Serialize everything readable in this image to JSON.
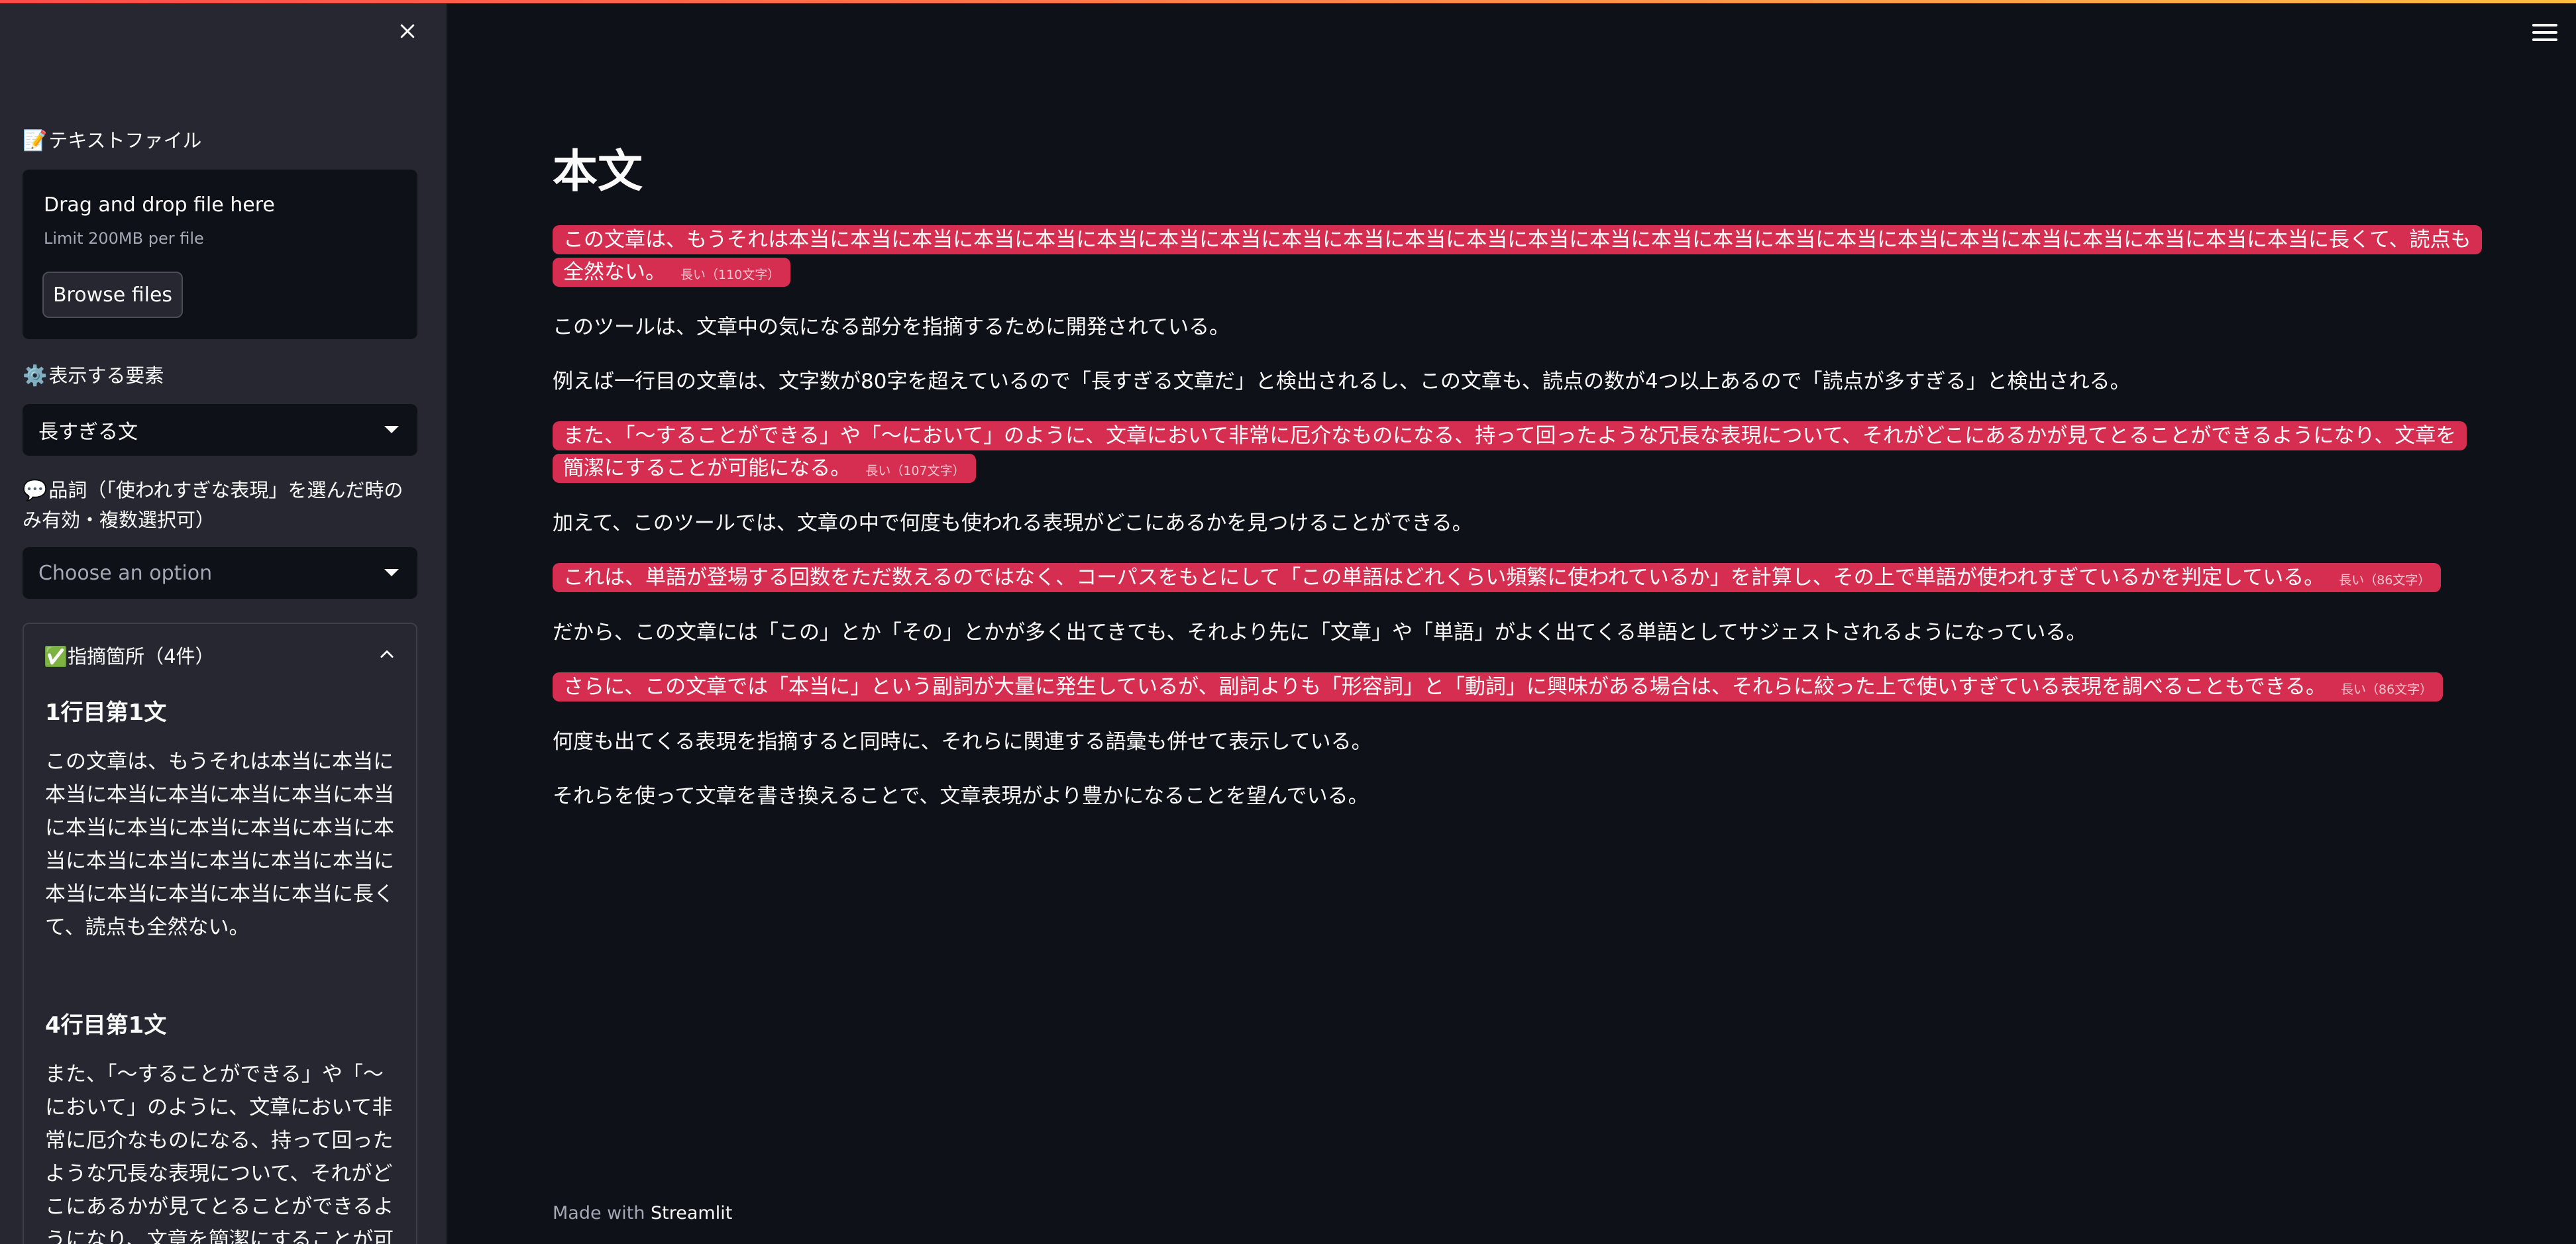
{
  "sidebar": {
    "close_icon": "close-icon",
    "file_label_emoji": "📝",
    "file_label": "テキストファイル",
    "uploader": {
      "title": "Drag and drop file here",
      "limit": "Limit 200MB per file",
      "browse_label": "Browse files"
    },
    "element_label_emoji": "⚙️",
    "element_label": "表示する要素",
    "element_select_value": "長すぎる文",
    "pos_label_emoji": "💬",
    "pos_label": "品詞（「使われすぎな表現」を選んだ時のみ有効・複数選択可）",
    "pos_select_placeholder": "Choose an option",
    "expander": {
      "emoji": "✅",
      "title": "指摘箇所（4件）",
      "findings": [
        {
          "heading": "1行目第1文",
          "text": "この文章は、もうそれは本当に本当に本当に本当に本当に本当に本当に本当に本当に本当に本当に本当に本当に本当に本当に本当に本当に本当に本当に本当に本当に本当に本当に本当に長くて、読点も全然ない。"
        },
        {
          "heading": "4行目第1文",
          "text": "また、「〜することができる」や「〜において」のように、文章において非常に厄介なものになる、持って回ったような冗長な表現について、それがどこにあるかが見てとることができるようになり、文章を簡潔にすることが可能になる。"
        }
      ]
    }
  },
  "main": {
    "title": "本文",
    "lines": [
      {
        "text": "この文章は、もうそれは本当に本当に本当に本当に本当に本当に本当に本当に本当に本当に本当に本当に本当に本当に本当に本当に本当に本当に本当に本当に本当に本当に本当に本当に本当に長くて、読点も全然ない。",
        "tag": "長い（110文字）"
      },
      {
        "text": "このツールは、文章中の気になる部分を指摘するために開発されている。",
        "tag": ""
      },
      {
        "text": "例えば一行目の文章は、文字数が80字を超えているので「長すぎる文章だ」と検出されるし、この文章も、読点の数が4つ以上あるので「読点が多すぎる」と検出される。",
        "tag": ""
      },
      {
        "text": "また、「〜することができる」や「〜において」のように、文章において非常に厄介なものになる、持って回ったような冗長な表現について、それがどこにあるかが見てとることができるようになり、文章を簡潔にすることが可能になる。",
        "tag": "長い（107文字）"
      },
      {
        "text": "加えて、このツールでは、文章の中で何度も使われる表現がどこにあるかを見つけることができる。",
        "tag": ""
      },
      {
        "text": "これは、単語が登場する回数をただ数えるのではなく、コーパスをもとにして「この単語はどれくらい頻繁に使われているか」を計算し、その上で単語が使われすぎているかを判定している。",
        "tag": "長い（86文字）"
      },
      {
        "text": "だから、この文章には「この」とか「その」とかが多く出てきても、それより先に「文章」や「単語」がよく出てくる単語としてサジェストされるようになっている。",
        "tag": ""
      },
      {
        "text": "さらに、この文章では「本当に」という副詞が大量に発生しているが、副詞よりも「形容詞」と「動詞」に興味がある場合は、それらに絞った上で使いすぎている表現を調べることもできる。",
        "tag": "長い（86文字）"
      },
      {
        "text": "何度も出てくる表現を指摘すると同時に、それらに関連する語彙も併せて表示している。",
        "tag": ""
      },
      {
        "text": "それらを使って文章を書き換えることで、文章表現がより豊かになることを望んでいる。",
        "tag": ""
      }
    ]
  },
  "footer": {
    "prefix": "Made with ",
    "brand": "Streamlit"
  },
  "colors": {
    "background": "#0e1117",
    "sidebar": "#262730",
    "highlight": "#d62e50",
    "accent_start": "#ff4b4b",
    "accent_end": "#ffbd45"
  },
  "icons": {
    "menu": "hamburger-menu-icon",
    "chevron": "chevron-up-icon",
    "caret": "chevron-down-icon"
  }
}
